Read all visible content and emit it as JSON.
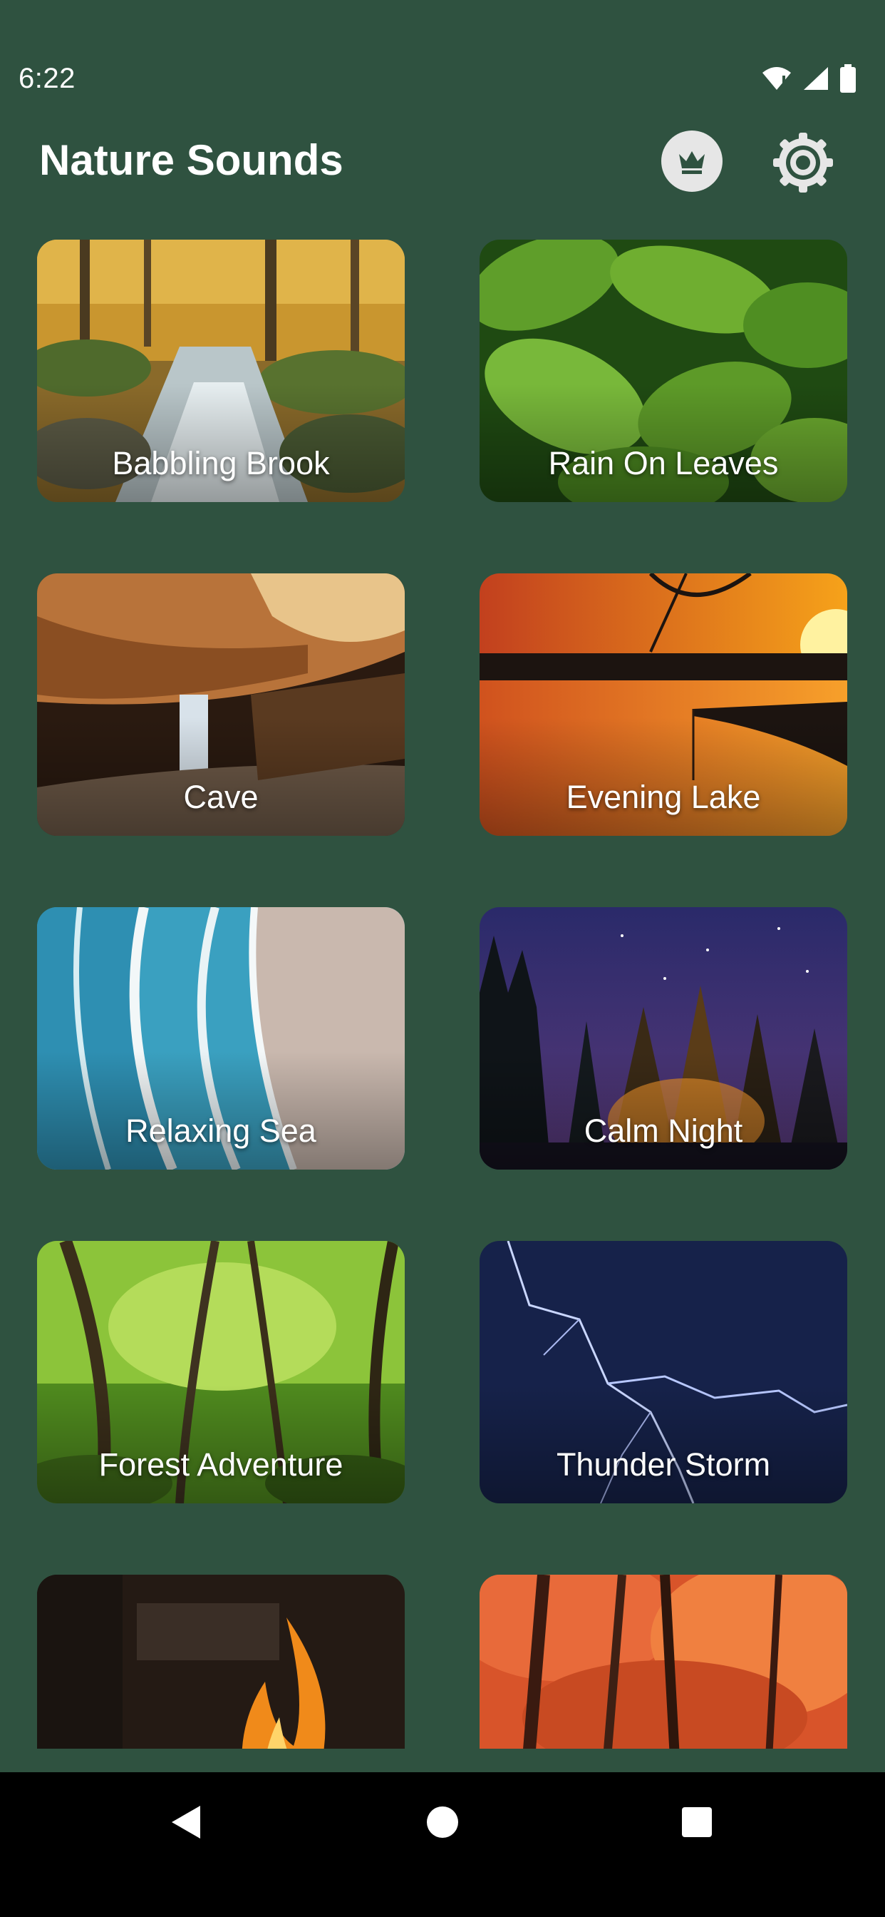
{
  "status_bar": {
    "time": "6:22",
    "icons": [
      "wifi-icon",
      "signal-icon",
      "battery-icon"
    ]
  },
  "app_bar": {
    "title": "Nature Sounds",
    "icons": [
      "crown-icon",
      "settings-icon"
    ]
  },
  "sounds": [
    {
      "label": "Babbling Brook"
    },
    {
      "label": "Rain On Leaves"
    },
    {
      "label": "Cave"
    },
    {
      "label": "Evening Lake"
    },
    {
      "label": "Relaxing Sea"
    },
    {
      "label": "Calm Night"
    },
    {
      "label": "Forest Adventure"
    },
    {
      "label": "Thunder Storm"
    },
    {
      "label": ""
    },
    {
      "label": ""
    }
  ],
  "nav_bar": {
    "icons": [
      "back-icon",
      "home-icon",
      "recents-icon"
    ]
  },
  "colors": {
    "background": "#2f5240",
    "nav_background": "#000000",
    "text": "#ffffff",
    "crown_button": "#e6e6e6"
  }
}
